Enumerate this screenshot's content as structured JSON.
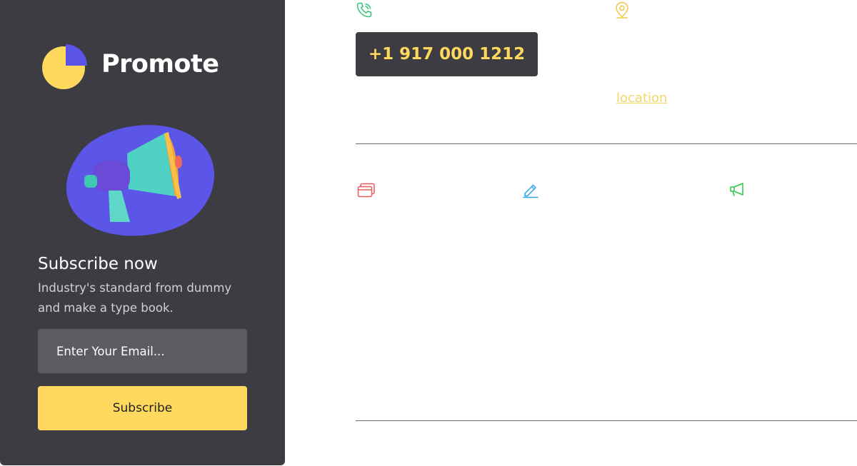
{
  "brand": {
    "name": "Promote"
  },
  "subscribe": {
    "title": "Subscribe now",
    "description": "Industry's standard from dummy and make a type  book.",
    "email_placeholder": "Enter Your Email...",
    "button_label": "Subscribe"
  },
  "contact": {
    "phone": "+1 917 000 1212",
    "location_link": "location"
  },
  "icons": {
    "phone": "phone-icon",
    "location": "map-pin-icon",
    "cards": "cards-icon",
    "pencil": "pencil-icon",
    "megaphone": "megaphone-icon"
  },
  "colors": {
    "sidebar_bg": "#3c3c42",
    "accent_yellow": "#ffd95e",
    "accent_purple": "#5b55e8",
    "phone_icon": "#34c47a",
    "pin_icon": "#f3c746",
    "cards_icon": "#ef5a5a",
    "pencil_icon": "#2aa3e8",
    "megaphone_icon": "#2bc94a"
  }
}
